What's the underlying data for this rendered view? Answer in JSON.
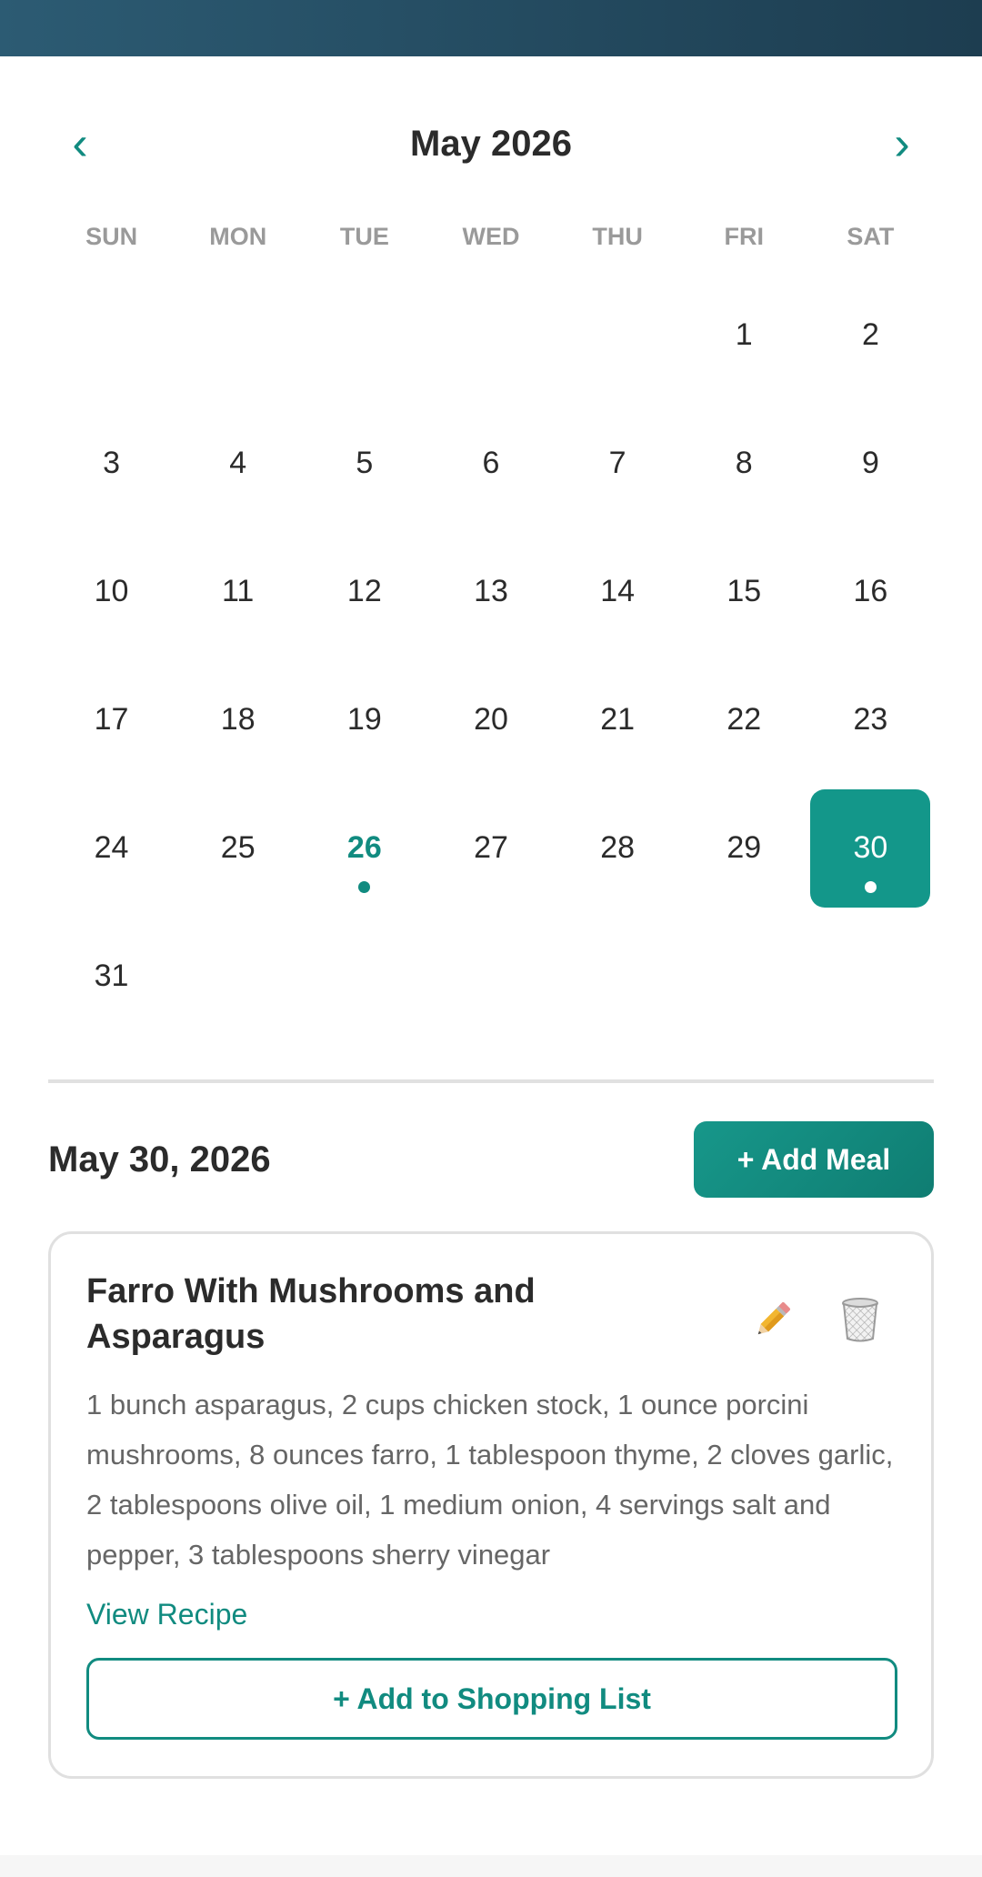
{
  "calendar": {
    "month_title": "May 2026",
    "prev_label": "‹",
    "next_label": "›",
    "weekdays": [
      "SUN",
      "MON",
      "TUE",
      "WED",
      "THU",
      "FRI",
      "SAT"
    ],
    "leading_blanks": 5,
    "days_in_month": 31,
    "today": 26,
    "selected": 30,
    "days_with_meals": [
      26,
      30
    ]
  },
  "selected_day": {
    "date_label": "May 30, 2026",
    "add_meal_label": "+ Add Meal"
  },
  "meal": {
    "title": "Farro With Mushrooms and Asparagus",
    "ingredients": "1 bunch asparagus, 2 cups chicken stock, 1 ounce porcini mushrooms, 8 ounces farro, 1 tablespoon thyme, 2 cloves garlic, 2 tablespoons olive oil, 1 medium onion, 4 servings salt and pepper, 3 tablespoons sherry vinegar",
    "edit_icon": "pencil-icon",
    "delete_icon": "trash-icon",
    "view_recipe_label": "View Recipe",
    "add_to_shopping_label": "+ Add to Shopping List"
  },
  "colors": {
    "accent": "#13978a",
    "header_bar": "#234a60",
    "muted_text": "#9a9a9a"
  }
}
